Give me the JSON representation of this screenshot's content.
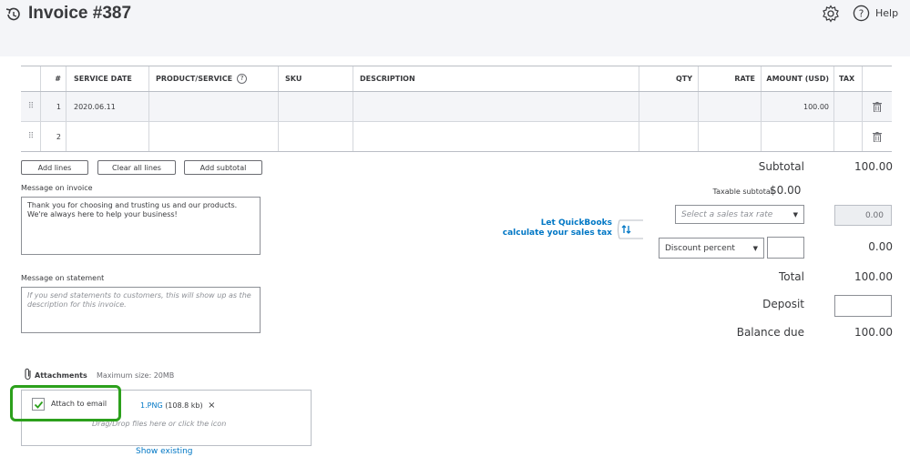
{
  "header": {
    "title": "Invoice #387",
    "help_label": "Help"
  },
  "table": {
    "columns": [
      "#",
      "SERVICE DATE",
      "PRODUCT/SERVICE",
      "SKU",
      "DESCRIPTION",
      "QTY",
      "RATE",
      "AMOUNT (USD)",
      "TAX"
    ],
    "rows": [
      {
        "num": "1",
        "service_date": "2020.06.11",
        "product": "",
        "sku": "",
        "description": "",
        "qty": "",
        "rate": "",
        "amount": "100.00",
        "tax": ""
      },
      {
        "num": "2",
        "service_date": "",
        "product": "",
        "sku": "",
        "description": "",
        "qty": "",
        "rate": "",
        "amount": "",
        "tax": ""
      }
    ]
  },
  "buttons": {
    "add_lines": "Add lines",
    "clear_all_lines": "Clear all lines",
    "add_subtotal": "Add subtotal"
  },
  "message_invoice": {
    "label": "Message on invoice",
    "value": "Thank you for choosing and trusting us and our products. We're always here to help your business!"
  },
  "message_statement": {
    "label": "Message on statement",
    "placeholder": "If you send statements to customers, this will show up as the description for this invoice."
  },
  "tax": {
    "link_line1": "Let QuickBooks",
    "link_line2": "calculate your sales tax",
    "taxable_subtotal_label": "Taxable subtotal",
    "taxable_subtotal_value": "$0.00",
    "rate_placeholder": "Select a sales tax rate",
    "tax_value": "0.00"
  },
  "discount": {
    "selected": "Discount percent",
    "value": "0.00"
  },
  "summary": {
    "subtotal_label": "Subtotal",
    "subtotal_value": "100.00",
    "total_label": "Total",
    "total_value": "100.00",
    "deposit_label": "Deposit",
    "balance_label": "Balance due",
    "balance_value": "100.00"
  },
  "attachments": {
    "label": "Attachments",
    "max_size": "Maximum size: 20MB",
    "attach_label": "Attach to email",
    "file_name": "1.PNG",
    "file_size": "(108.8 kb)",
    "remove": "×",
    "drop_hint": "Drag/Drop files here or click the icon",
    "show_existing": "Show existing"
  },
  "colors": {
    "accent_link": "#0077c5",
    "highlight_green": "#2ca01c",
    "header_bg": "#f4f5f8"
  }
}
